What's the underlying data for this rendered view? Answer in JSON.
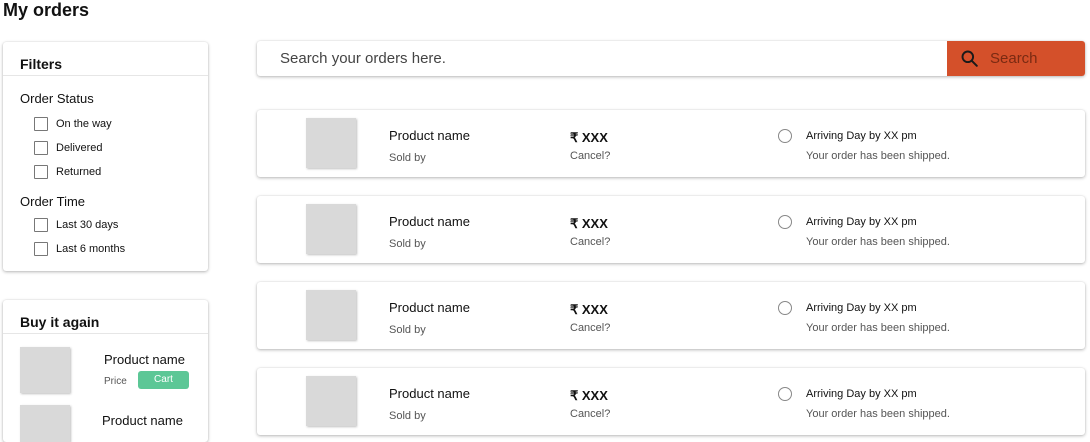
{
  "page": {
    "title": "My orders"
  },
  "filters": {
    "title": "Filters",
    "order_status": {
      "title": "Order Status",
      "options": [
        "On the way",
        "Delivered",
        "Returned"
      ]
    },
    "order_time": {
      "title": "Order Time",
      "options": [
        "Last 30 days",
        "Last 6 months"
      ]
    }
  },
  "buy_again": {
    "title": "Buy it again",
    "items": [
      {
        "name": "Product name",
        "price_label": "Price",
        "cart_label": "Cart"
      },
      {
        "name": "Product name"
      }
    ]
  },
  "search": {
    "placeholder": "Search your orders here.",
    "button_label": "Search",
    "button_color": "#d4502a"
  },
  "orders": [
    {
      "name": "Product name",
      "seller": "Sold by",
      "price": "₹ XXX",
      "cancel": "Cancel?",
      "arriving": "Arriving Day by XX pm",
      "message": "Your order has been shipped."
    },
    {
      "name": "Product name",
      "seller": "Sold by",
      "price": "₹ XXX",
      "cancel": "Cancel?",
      "arriving": "Arriving Day by XX pm",
      "message": "Your order has been shipped."
    },
    {
      "name": "Product name",
      "seller": "Sold by",
      "price": "₹ XXX",
      "cancel": "Cancel?",
      "arriving": "Arriving Day by XX pm",
      "message": "Your order has been shipped."
    },
    {
      "name": "Product name",
      "seller": "Sold by",
      "price": "₹ XXX",
      "cancel": "Cancel?",
      "arriving": "Arriving Day by XX pm",
      "message": "Your order has been shipped."
    }
  ],
  "colors": {
    "cart_button": "#5cc796",
    "thumbnail": "#d9d9d9"
  }
}
